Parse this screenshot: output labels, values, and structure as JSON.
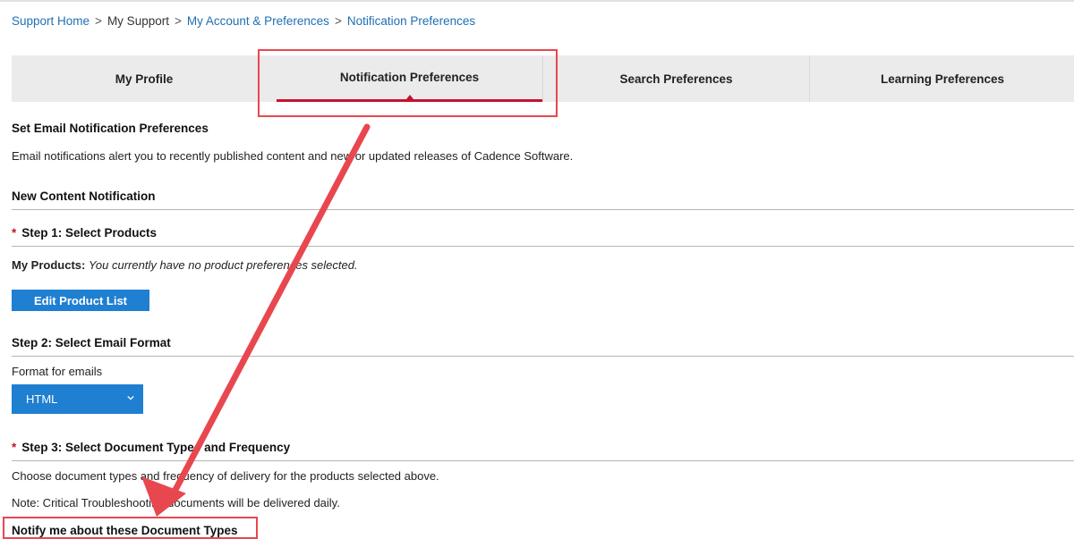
{
  "breadcrumb": {
    "items": [
      "Support Home",
      "My Support",
      "My Account & Preferences",
      "Notification Preferences"
    ],
    "separator": ">"
  },
  "tabs": [
    {
      "label": "My Profile",
      "active": false
    },
    {
      "label": "Notification Preferences",
      "active": true
    },
    {
      "label": "Search Preferences",
      "active": false
    },
    {
      "label": "Learning Preferences",
      "active": false
    }
  ],
  "main": {
    "section_title": "Set Email Notification Preferences",
    "intro": "Email notifications alert you to recently published content and new or updated releases of Cadence Software.",
    "new_content_title": "New Content Notification",
    "required_mark": "*",
    "step1": {
      "title": "Step 1: Select Products",
      "my_products_label": "My Products:",
      "my_products_value": "You currently have no product preferences selected.",
      "edit_button": "Edit Product List"
    },
    "step2": {
      "title": "Step 2: Select Email Format",
      "format_label": "Format for emails",
      "format_value": "HTML"
    },
    "step3": {
      "title": "Step 3: Select Document Types and Frequency",
      "desc": "Choose document types and frequency of delivery for the products selected above.",
      "note": "Note: Critical Troubleshooting documents will be delivered daily.",
      "notify_title": "Notify me about these Document Types"
    }
  },
  "colors": {
    "accent_blue": "#1f7fd1",
    "link_blue": "#1f6fb3",
    "tab_active_red": "#c8102e",
    "annotation_red": "#e8474f"
  },
  "icons": [
    "chevron-down-icon"
  ]
}
